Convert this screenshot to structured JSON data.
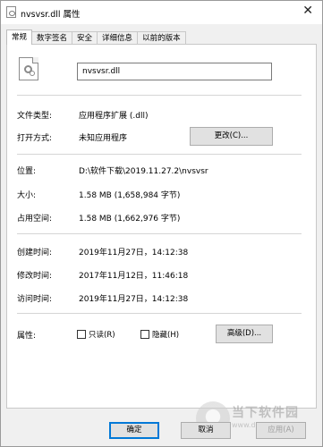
{
  "window": {
    "title": "nvsvsr.dll 属性",
    "close_glyph": "✕"
  },
  "tabs": [
    "常规",
    "数字签名",
    "安全",
    "详细信息",
    "以前的版本"
  ],
  "general": {
    "file_name": "nvsvsr.dll",
    "type_label": "文件类型:",
    "type_value": "应用程序扩展 (.dll)",
    "opens_label": "打开方式:",
    "opens_value": "未知应用程序",
    "change_button": "更改(C)...",
    "location_label": "位置:",
    "location_value": "D:\\软件下载\\2019.11.27.2\\nvsvsr",
    "size_label": "大小:",
    "size_value": "1.58 MB (1,658,984 字节)",
    "size_on_disk_label": "占用空间:",
    "size_on_disk_value": "1.58 MB (1,662,976 字节)",
    "created_label": "创建时间:",
    "created_value": "2019年11月27日，14:12:38",
    "modified_label": "修改时间:",
    "modified_value": "2017年11月12日，11:46:18",
    "accessed_label": "访问时间:",
    "accessed_value": "2019年11月27日，14:12:38",
    "attributes_label": "属性:",
    "readonly_label": "只读(R)",
    "hidden_label": "隐藏(H)",
    "advanced_button": "高级(D)..."
  },
  "footer": {
    "ok": "确定",
    "cancel": "取消",
    "apply": "应用(A)"
  },
  "watermark": {
    "title": "当下软件园",
    "url": "www.downxia.com"
  },
  "icons": {
    "file_icon": "dll-file-icon",
    "close_icon": "close-icon"
  }
}
